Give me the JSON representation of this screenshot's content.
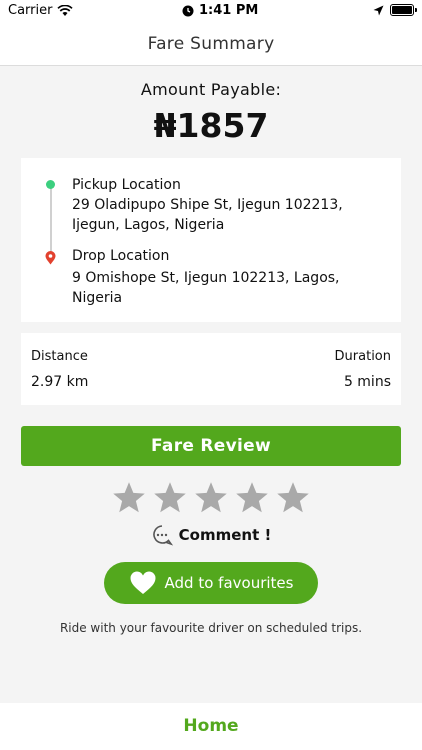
{
  "status_bar": {
    "carrier": "Carrier",
    "time": "1:41 PM"
  },
  "header": {
    "title": "Fare Summary"
  },
  "fare": {
    "amount_label": "Amount Payable:",
    "amount": "₦1857"
  },
  "route": {
    "pickup_title": "Pickup Location",
    "pickup_address": "29 Oladipupo Shipe St, Ijegun 102213, Ijegun, Lagos, Nigeria",
    "drop_title": "Drop Location",
    "drop_address": "9 Omishope St, Ijegun 102213, Lagos, Nigeria"
  },
  "trip": {
    "distance_label": "Distance",
    "distance_value": "2.97 km",
    "duration_label": "Duration",
    "duration_value": "5 mins"
  },
  "actions": {
    "fare_review": "Fare Review",
    "comment": "Comment !",
    "add_favourites": "Add to favourites",
    "favourites_note": "Ride with your favourite driver on scheduled trips."
  },
  "rating": {
    "max": 5,
    "value": 0
  },
  "bottom_nav": {
    "home": "Home"
  },
  "colors": {
    "accent": "#53a81d",
    "pickup": "#3ccf7f",
    "drop": "#e2412e",
    "star_empty": "#a9a9a9"
  },
  "icons": [
    "wifi-icon",
    "location-arrow-icon",
    "alarm-icon",
    "battery-icon",
    "pickup-dot-icon",
    "drop-pin-icon",
    "star-icon",
    "comment-icon",
    "heart-icon"
  ]
}
